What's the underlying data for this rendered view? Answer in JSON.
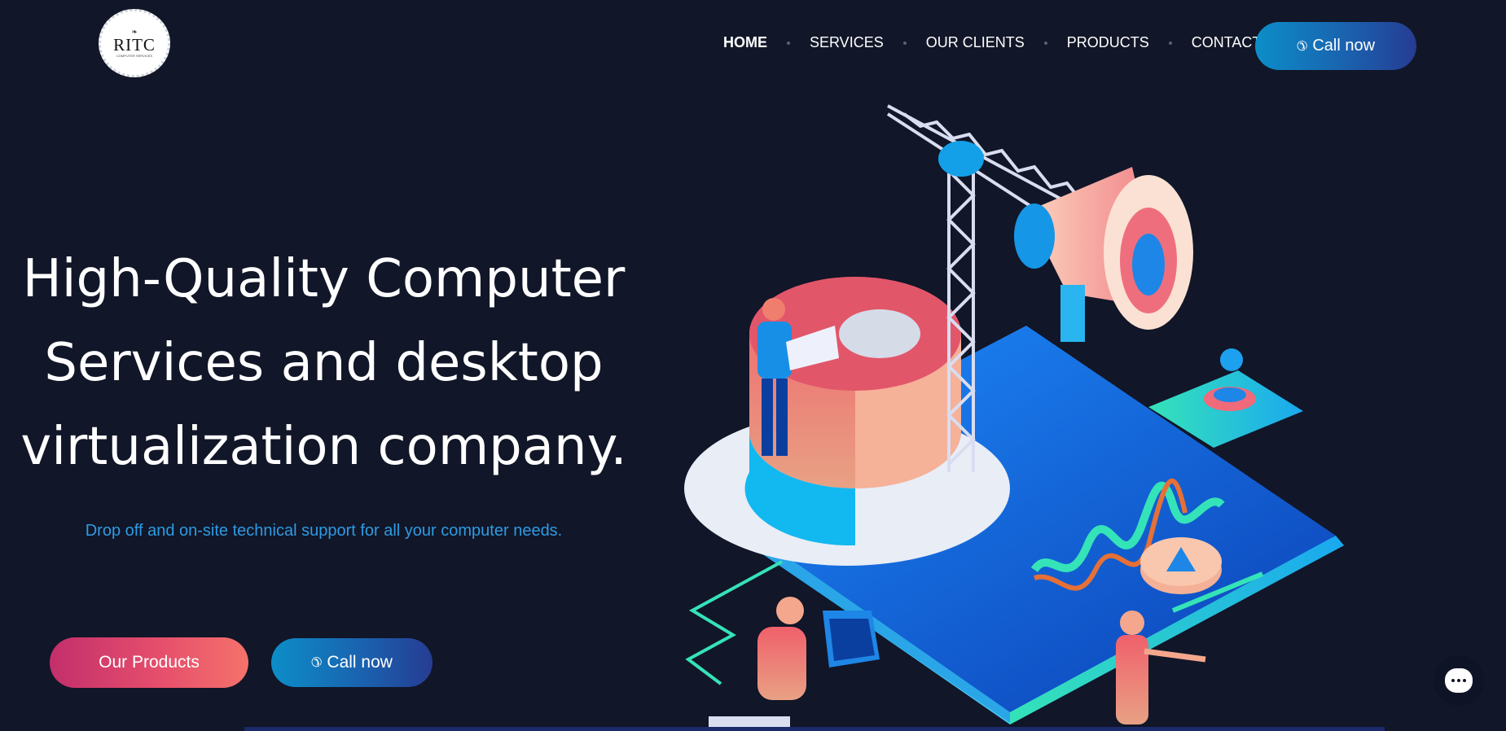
{
  "brand": {
    "logo_text": "RITC",
    "logo_mark": "❧",
    "logo_sub": "COMPUTER SERVICES"
  },
  "nav": {
    "items": [
      {
        "label": "HOME",
        "active": true
      },
      {
        "label": "SERVICES",
        "active": false
      },
      {
        "label": "OUR CLIENTS",
        "active": false
      },
      {
        "label": "PRODUCTS",
        "active": false
      },
      {
        "label": "CONTACT",
        "active": false
      }
    ],
    "call_button": {
      "label": "Call now",
      "icon": "phone-icon"
    }
  },
  "hero": {
    "title_lines": [
      "High-Quality Computer",
      "Services and desktop",
      "virtualization company."
    ],
    "subtitle": "Drop off and on-site technical support for all your computer needs.",
    "primary_button": "Our Products",
    "secondary_button": {
      "label": "Call now",
      "icon": "phone-icon"
    }
  },
  "chat": {
    "icon": "chat-bubble-icon"
  },
  "colors": {
    "background": "#111628",
    "accent_blue": "#0c8ec8",
    "accent_pink": "#e64e6c",
    "subtitle_blue": "#2d9be3"
  }
}
